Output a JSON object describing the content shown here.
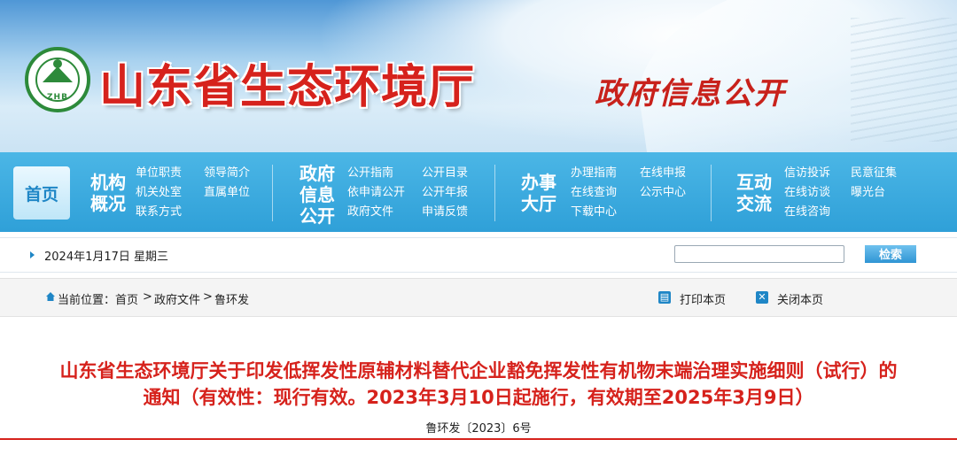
{
  "header": {
    "logo_text": "ZHB",
    "site_title": "山东省生态环境厅",
    "gov_info": "政府信息公开"
  },
  "nav": {
    "home": "首页",
    "groups": [
      {
        "title_line1": "机构",
        "title_line2": "概况",
        "title_line3": "",
        "links": [
          "单位职责",
          "领导简介",
          "机关处室",
          "直属单位",
          "联系方式"
        ]
      },
      {
        "title_line1": "政府",
        "title_line2": "信息",
        "title_line3": "公开",
        "links": [
          "公开指南",
          "公开目录",
          "依申请公开",
          "公开年报",
          "政府文件",
          "申请反馈"
        ]
      },
      {
        "title_line1": "办事",
        "title_line2": "大厅",
        "title_line3": "",
        "links": [
          "办理指南",
          "在线申报",
          "在线查询",
          "公示中心",
          "下载中心"
        ]
      },
      {
        "title_line1": "互动",
        "title_line2": "交流",
        "title_line3": "",
        "links": [
          "信访投诉",
          "民意征集",
          "在线访谈",
          "曝光台",
          "在线咨询"
        ]
      }
    ]
  },
  "infobar": {
    "date": "2024年1月17日 星期三",
    "search_value": "",
    "search_button": "检索"
  },
  "breadcrumb": {
    "label": "当前位置：",
    "items": [
      "首页",
      ">",
      "政府文件",
      ">",
      "鲁环发"
    ],
    "print": "打印本页",
    "close": "关闭本页"
  },
  "article": {
    "title_line1": "山东省生态环境厅关于印发低挥发性原辅材料替代企业豁免挥发性有机物末端治理实施细则（试行）的",
    "title_line2": "通知（有效性：现行有效。2023年3月10日起施行，有效期至2025年3月9日）",
    "doc_number": "鲁环发〔2023〕6号"
  }
}
